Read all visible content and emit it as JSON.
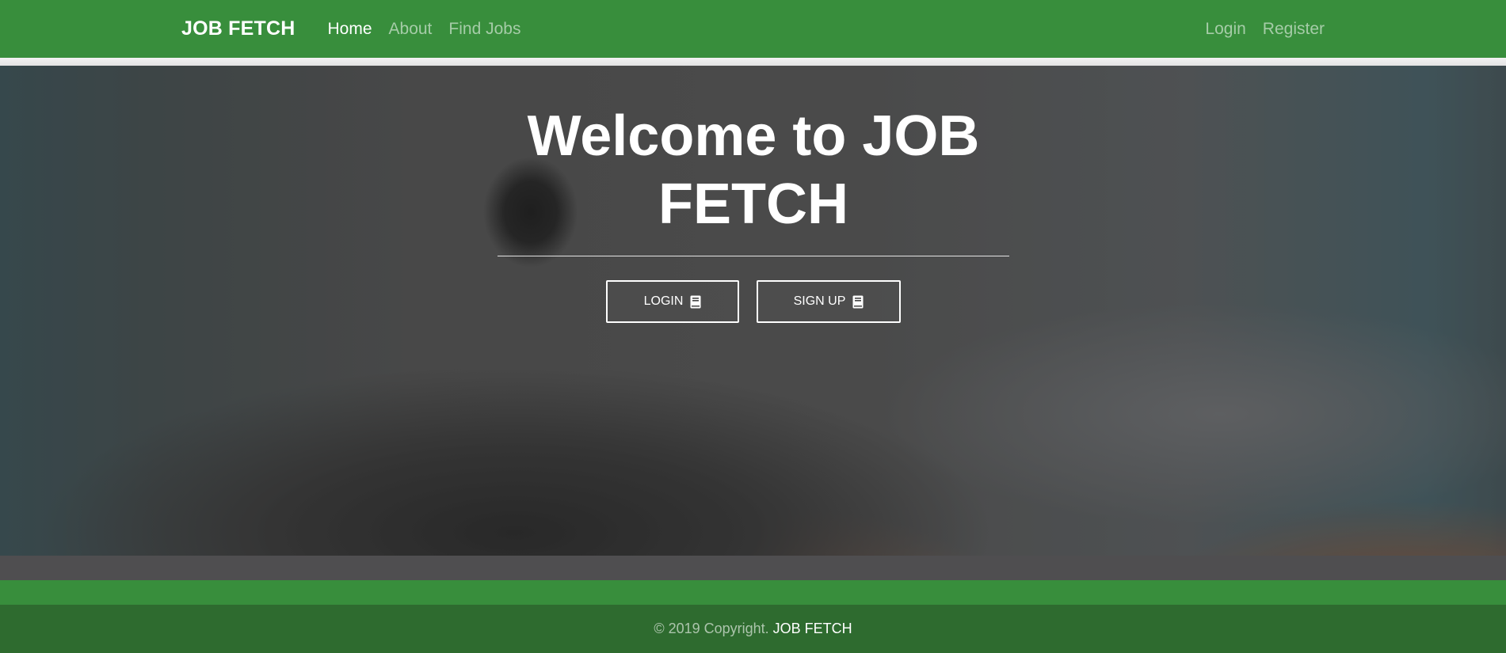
{
  "navbar": {
    "brand": "JOB FETCH",
    "links": [
      {
        "label": "Home"
      },
      {
        "label": "About"
      },
      {
        "label": "Find Jobs"
      }
    ],
    "right_links": [
      {
        "label": "Login"
      },
      {
        "label": "Register"
      }
    ]
  },
  "hero": {
    "title_line1": "Welcome to JOB",
    "title_line2": "FETCH",
    "buttons": {
      "login_label": "LOGIN",
      "signup_label": "SIGN UP"
    },
    "icons": {
      "login_icon": "book-icon",
      "signup_icon": "book-icon"
    }
  },
  "footer": {
    "copyright": "© 2019 Copyright.",
    "brand": "JOB FETCH"
  },
  "colors": {
    "navbar_green": "#388e3c",
    "footer_green": "#2e6b2f",
    "text_white": "#ffffff"
  }
}
